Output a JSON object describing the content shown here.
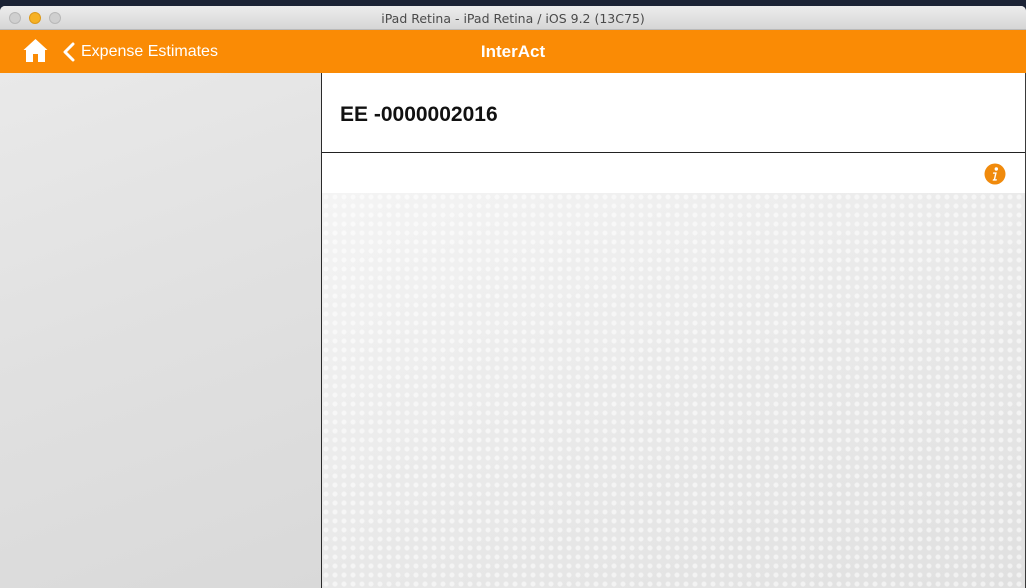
{
  "window": {
    "title": "iPad Retina - iPad Retina / iOS 9.2 (13C75)"
  },
  "navbar": {
    "home_icon": "home-icon",
    "back_label": "Expense Estimates",
    "title": "InterAct",
    "accent_color": "#fa8b05"
  },
  "record": {
    "id": "EE -0000002016",
    "info_icon": "info-icon"
  }
}
